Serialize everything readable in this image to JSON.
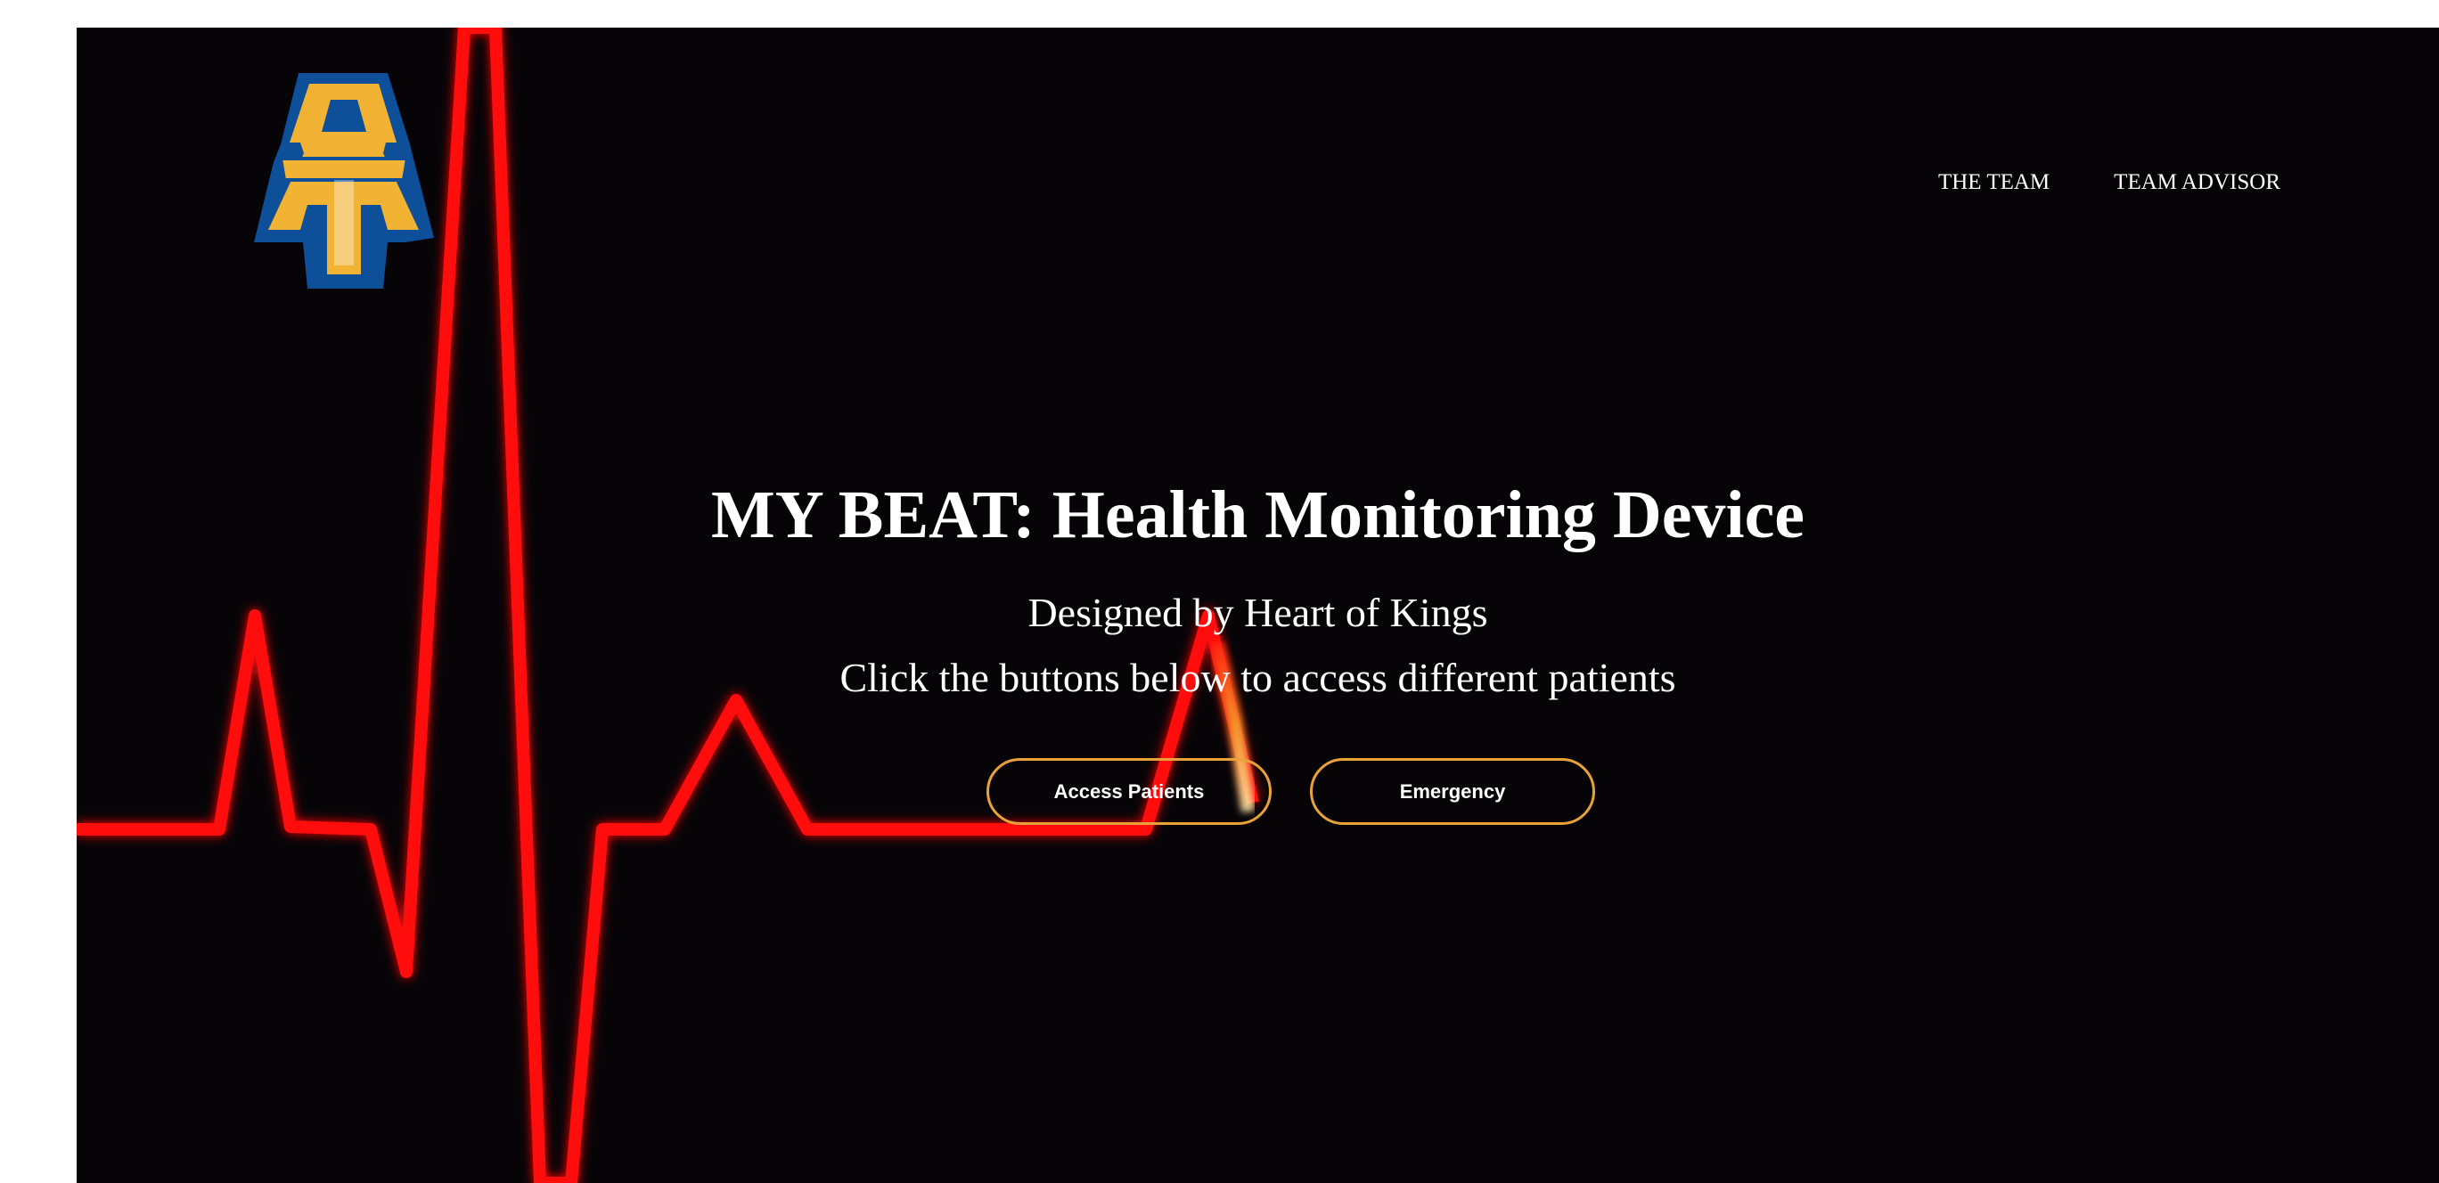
{
  "nav": {
    "items": [
      {
        "label": "THE TEAM"
      },
      {
        "label": "TEAM ADVISOR"
      }
    ]
  },
  "hero": {
    "title": "MY BEAT: Health Monitoring Device",
    "subtitle": "Designed by Heart of Kings",
    "instruction": "Click the buttons below to access different patients"
  },
  "buttons": {
    "access_label": "Access Patients",
    "emergency_label": "Emergency"
  },
  "colors": {
    "background": "#060407",
    "ecg_line": "#ff0a0a",
    "button_border": "#e9a13a",
    "logo_gold": "#f2b233",
    "logo_blue": "#0e4f9a"
  },
  "logo": {
    "name": "at-logo-icon",
    "letters": "AT"
  }
}
